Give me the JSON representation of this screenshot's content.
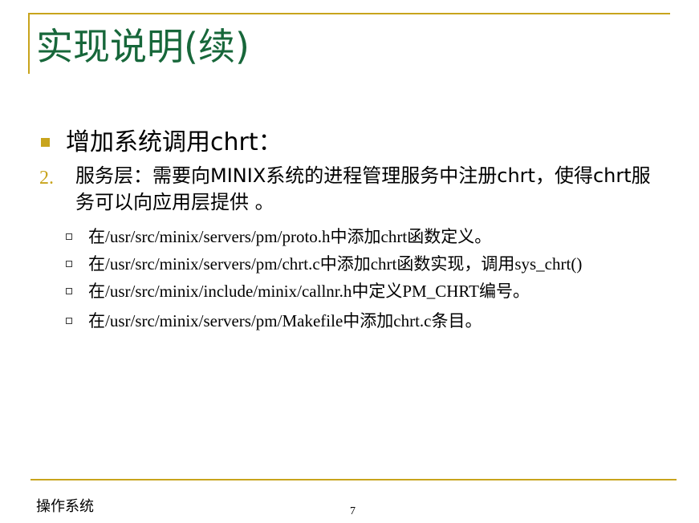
{
  "title": "实现说明(续)",
  "bullet1": "增加系统调用chrt：",
  "item2": {
    "number": "2.",
    "text": "服务层：需要向MINIX系统的进程管理服务中注册chrt，使得chrt服务可以向应用层提供 。"
  },
  "subitems": [
    "在/usr/src/minix/servers/pm/proto.h中添加chrt函数定义。",
    "在/usr/src/minix/servers/pm/chrt.c中添加chrt函数实现，调用sys_chrt()",
    "在/usr/src/minix/include/minix/callnr.h中定义PM_CHRT编号。",
    "在/usr/src/minix/servers/pm/Makefile中添加chrt.c条目。"
  ],
  "footer": {
    "label": "操作系统",
    "page": "7"
  },
  "colors": {
    "accent": "#c8a41c",
    "title": "#17673a"
  }
}
